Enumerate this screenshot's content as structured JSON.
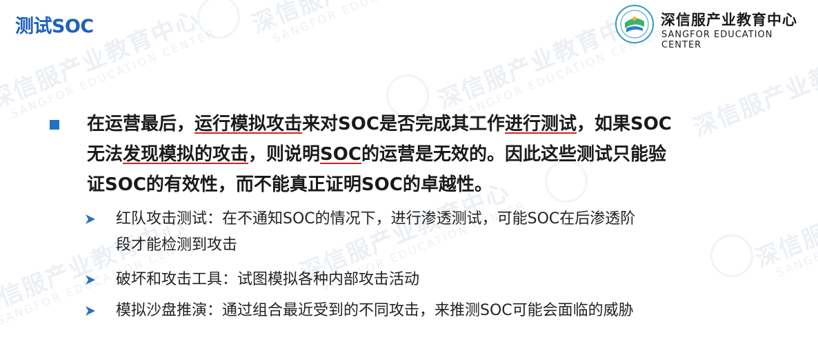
{
  "header": {
    "title": "测试SOC"
  },
  "logo": {
    "name_cn": "深信服产业教育中心",
    "name_en": "SANGFOR EDUCATION CENTER"
  },
  "main_bullet": {
    "line1": {
      "a": "在运营最后，",
      "b": "运行模拟攻击",
      "c": "来对SOC是否完成其工作",
      "d": "进行测试",
      "e": "，如果SOC"
    },
    "line2": {
      "a": "无法",
      "b": "发现模拟的攻击",
      "c": "，则说明",
      "d": "SOC",
      "e": "的运营是无效的。因此这些测试只能验"
    },
    "line3": "证SOC的有效性，而不能真正证明SOC的卓越性。"
  },
  "sub_bullets": [
    {
      "line1": "红队攻击测试：在不通知SOC的情况下，进行渗透测试，可能SOC在后渗透阶",
      "line2": "段才能检测到攻击"
    },
    {
      "line1": "破坏和攻击工具：试图模拟各种内部攻击活动"
    },
    {
      "line1": "模拟沙盘推演：通过组合最近受到的不同攻击，来推测SOC可能会面临的威胁"
    }
  ],
  "colors": {
    "title": "#1f5fbf",
    "bullet": "#1f72c8",
    "underline": "#d42020",
    "arrow": "#2a6fc0"
  }
}
